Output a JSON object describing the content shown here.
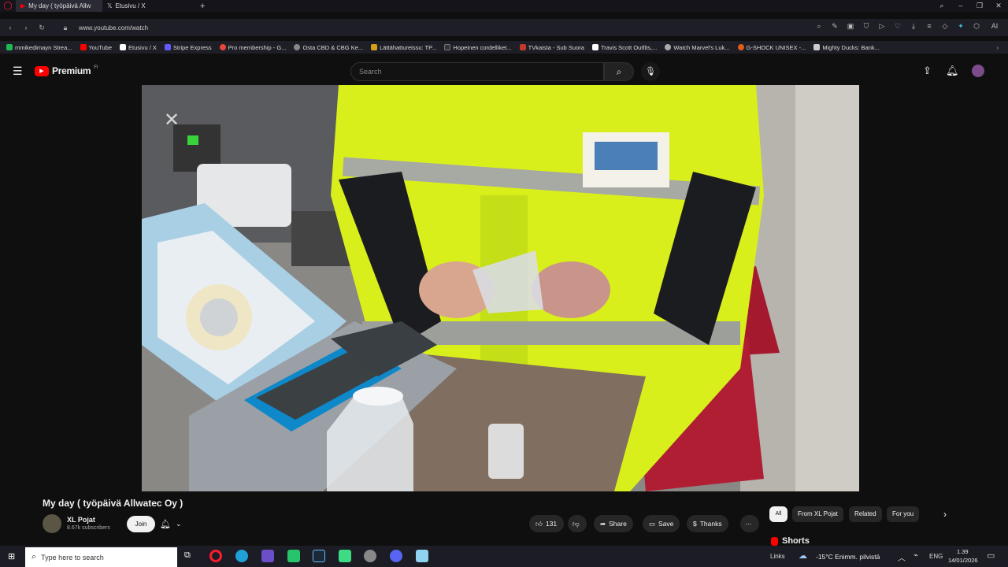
{
  "browser": {
    "tabs": [
      {
        "label": "My day ( työpäivä Allw"
      },
      {
        "label": "Etusivu / X"
      }
    ],
    "url": "www.youtube.com/watch",
    "bookmarks": [
      {
        "label": "mmikedimayn Strea...",
        "color": "#1db954"
      },
      {
        "label": "YouTube",
        "color": "#ff0000"
      },
      {
        "label": "Etusivu / X",
        "color": "#ffffff"
      },
      {
        "label": "Stripe Express",
        "color": "#635bff"
      },
      {
        "label": "Pro membership - G...",
        "color": "#e8453c"
      },
      {
        "label": "Osta CBD & CBG Ke...",
        "color": "#888888"
      },
      {
        "label": "Lättähattureissu: TP...",
        "color": "#d4a017"
      },
      {
        "label": "Hopeinen cordelliket...",
        "color": "#333333"
      },
      {
        "label": "TVkaista - Sub Suora",
        "color": "#c0392b"
      },
      {
        "label": "Travis Scott Outfits,...",
        "color": "#ffffff"
      },
      {
        "label": "Watch Marvel's Luk...",
        "color": "#aaaaaa"
      },
      {
        "label": "G-SHOCK UNISEX -...",
        "color": "#e05a1a"
      },
      {
        "label": "Mighty Ducks: Bank...",
        "color": "#cccccc"
      }
    ]
  },
  "youtube": {
    "logo_label": "Premium",
    "logo_suffix": "FI",
    "search_placeholder": "Search",
    "video_title": "My day ( työpäivä Allwatec Oy )",
    "channel_name": "XL Pojat",
    "subscribers": "8.67k subscribers",
    "join_label": "Join",
    "likes": "131",
    "share_label": "Share",
    "save_label": "Save",
    "thanks_label": "Thanks",
    "chips": [
      "All",
      "From XL Pojat",
      "Related",
      "For you"
    ],
    "shorts_label": "Shorts"
  },
  "taskbar": {
    "search_placeholder": "Type here to search",
    "links_label": "Links",
    "weather": "-15°C  Enimm. pilvistä",
    "lang": "ENG",
    "time": "1.39",
    "date": "14/01/2026"
  }
}
